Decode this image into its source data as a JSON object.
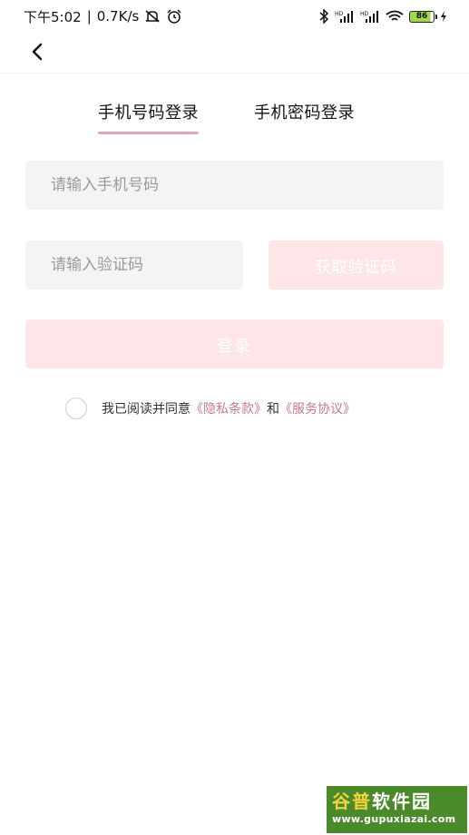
{
  "status_bar": {
    "time": "下午5:02",
    "separator": "|",
    "speed": "0.7K/s",
    "battery": "86",
    "icons": [
      "mute-icon",
      "alarm-icon",
      "bluetooth-icon",
      "signal-hd-icon",
      "signal-hd-icon",
      "wifi-icon",
      "battery-icon",
      "charging-icon"
    ]
  },
  "nav": {
    "back_icon": "chevron-left-icon"
  },
  "tabs": [
    {
      "label": "手机号码登录",
      "active": true
    },
    {
      "label": "手机密码登录",
      "active": false
    }
  ],
  "form": {
    "phone_placeholder": "请输入手机号码",
    "phone_value": "",
    "code_placeholder": "请输入验证码",
    "code_value": "",
    "get_code_label": "获取验证码",
    "login_label": "登录"
  },
  "agreement": {
    "text": "我已阅读并同意",
    "privacy_link": "《隐私条款》",
    "and": "和",
    "service_link": "《服务协议》",
    "checked": false
  },
  "colors": {
    "accent": "#e2a7b6",
    "link": "#c97a92",
    "button_disabled_bg": "#fde5e8",
    "input_bg": "#f4f4f4"
  },
  "watermark": {
    "title_part1": "谷普",
    "title_part2": "软件园",
    "url": "www.gupuxiazai.com"
  }
}
